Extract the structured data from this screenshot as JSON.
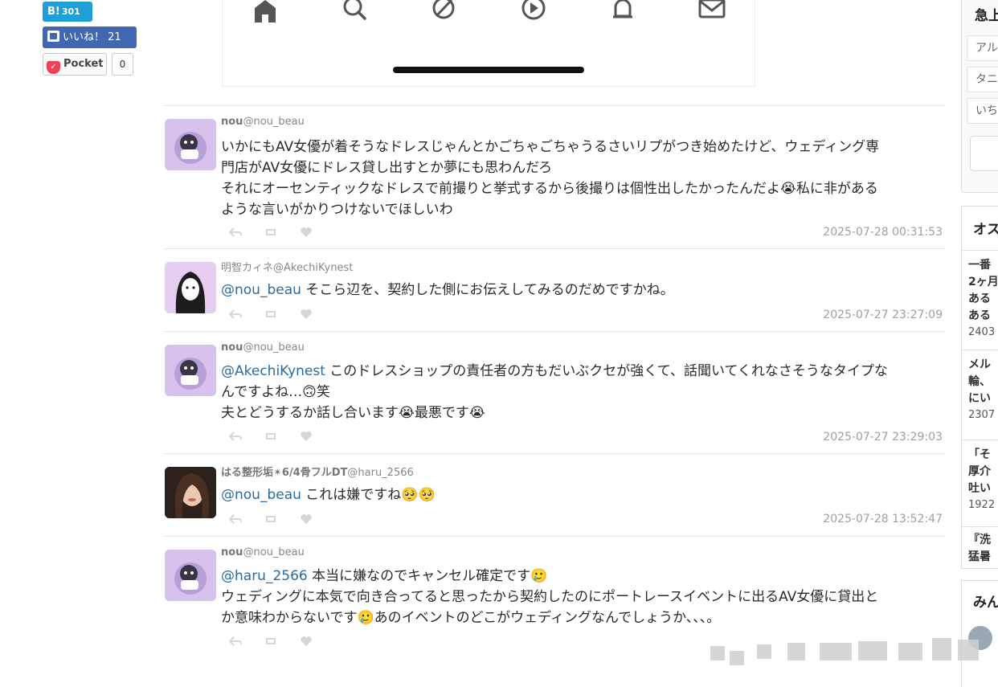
{
  "share": {
    "hatena_label": "B!",
    "hatena_count": "301",
    "facebook_label": "いいね！",
    "facebook_count": "21",
    "pocket_label": "Pocket",
    "pocket_count": "0"
  },
  "phone_nav": {
    "icons": [
      "home-icon",
      "search-icon",
      "explore-icon",
      "play-icon",
      "bell-icon",
      "mail-icon"
    ]
  },
  "tweets": [
    {
      "name": "nou",
      "handle": "@nou_beau",
      "lines": [
        "いかにもAV女優が着そうなドレスじゃんとかごちゃごちゃうるさいリプがつき始めたけど、ウェディング専",
        "門店がAV女優にドレス貸し出すとか夢にも思わんだろ",
        "それにオーセンティックなドレスで前撮りと挙式するから後撮りは個性出したかったんだよ😭私に非がある",
        "ような言いがかりつけないでほしいわ"
      ],
      "timestamp": "2025-07-28 00:31:53"
    },
    {
      "name": "明智カィネ",
      "handle": "@AkechiKynest",
      "mention": "@nou_beau",
      "lines": [
        " そこら辺を、契約した側にお伝えしてみるのだめですかね。"
      ],
      "timestamp": "2025-07-27 23:27:09"
    },
    {
      "name": "nou",
      "handle": "@nou_beau",
      "mention": "@AkechiKynest",
      "lines": [
        " このドレスショップの責任者の方もだいぶクセが強くて、話聞いてくれなさそうなタイプな",
        "んですよね…🙃笑",
        "夫とどうするか話し合います😭最悪です😭"
      ],
      "timestamp": "2025-07-27 23:29:03"
    },
    {
      "name": "はる整形垢✴︎6/4骨フルDT",
      "handle": "@haru_2566",
      "mention": "@nou_beau",
      "lines": [
        " これは嫌ですね🥺🥺"
      ],
      "timestamp": "2025-07-28 13:52:47"
    },
    {
      "name": "nou",
      "handle": "@nou_beau",
      "mention": "@haru_2566",
      "lines": [
        " 本当に嫌なのでキャンセル確定です🥲",
        "ウェディングに本気で向き合ってると思ったから契約したのにポートレースイベントに出るAV女優に貸出と",
        "か意味わからないです🥲あのイベントのどこがウェディングなんでしょうか、、、。"
      ]
    }
  ],
  "sidebar": {
    "box1_title": "急上",
    "box1_items": [
      "アル",
      "タニ",
      "いち"
    ],
    "box2_title": "オス",
    "entries": [
      {
        "lines": [
          "一番",
          "2ヶ月",
          "ある",
          "ある"
        ],
        "count": "2403"
      },
      {
        "lines": [
          "メル",
          "輪、",
          "にい"
        ],
        "count": "2307"
      },
      {
        "lines": [
          "「そ",
          "厚介",
          "吐い"
        ],
        "count": "1922"
      },
      {
        "lines": [
          "『洗",
          "猛暑"
        ]
      }
    ],
    "box3_title": "みん"
  },
  "colors": {
    "hatena": "#1e9fd8",
    "facebook": "#4267b2",
    "pocket": "#ee4056",
    "mention": "#2d6a9f",
    "timestamp": "#a0a0a0"
  }
}
